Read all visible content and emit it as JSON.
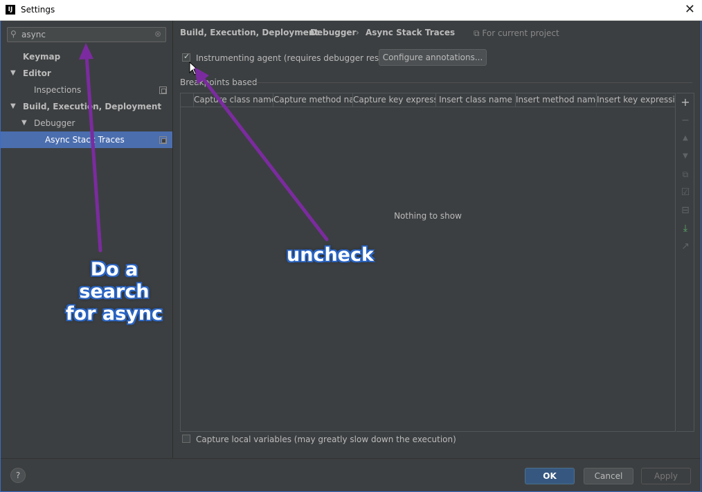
{
  "window": {
    "title": "Settings",
    "app_icon": "IJ",
    "close_glyph": "✕"
  },
  "search": {
    "value": "async",
    "icon": "search-icon",
    "clear_glyph": "⊗"
  },
  "tree": {
    "items": [
      {
        "label": "Keymap",
        "arrow": ""
      },
      {
        "label": "Editor",
        "arrow": "▼"
      },
      {
        "label": "Inspections",
        "arrow": ""
      },
      {
        "label": "Build, Execution, Deployment",
        "arrow": "▼"
      },
      {
        "label": "Debugger",
        "arrow": "▼"
      },
      {
        "label": "Async Stack Traces",
        "arrow": ""
      }
    ]
  },
  "breadcrumb": {
    "items": [
      "Build, Execution, Deployment",
      "Debugger",
      "Async Stack Traces"
    ],
    "separator": "›",
    "project_note": "For current project"
  },
  "agent": {
    "label": "Instrumenting agent (requires debugger restart)",
    "checked": true,
    "configure_label": "Configure annotations..."
  },
  "section": {
    "title": "Breakpoints based"
  },
  "table": {
    "columns": [
      "Capture class name",
      "Capture method na...",
      "Capture key expressi...",
      "Insert class name",
      "Insert method name",
      "Insert key expression"
    ],
    "empty_text": "Nothing to show"
  },
  "toolbar": {
    "icons": [
      "plus-icon",
      "minus-icon",
      "up-icon",
      "down-icon",
      "copy-icon",
      "check-icon",
      "uncheck-icon",
      "import-icon",
      "export-icon"
    ],
    "glyphs": [
      "+",
      "−",
      "▲",
      "▼",
      "⧉",
      "☑",
      "⊟",
      "⤓",
      "↗"
    ]
  },
  "capture_local": {
    "label": "Capture local variables (may greatly slow down the execution)",
    "checked": false
  },
  "footer": {
    "help": "?",
    "ok": "OK",
    "cancel": "Cancel",
    "apply": "Apply"
  },
  "annotations": {
    "search_note_line1": "Do a search",
    "search_note_line2": "for async",
    "uncheck_note": "uncheck",
    "arrow_color": "#7b2b9f",
    "text_outline_color": "#2a65c4"
  },
  "colors": {
    "selection": "#4b6eaf",
    "background": "#3c3f41",
    "ok_button": "#365880"
  }
}
